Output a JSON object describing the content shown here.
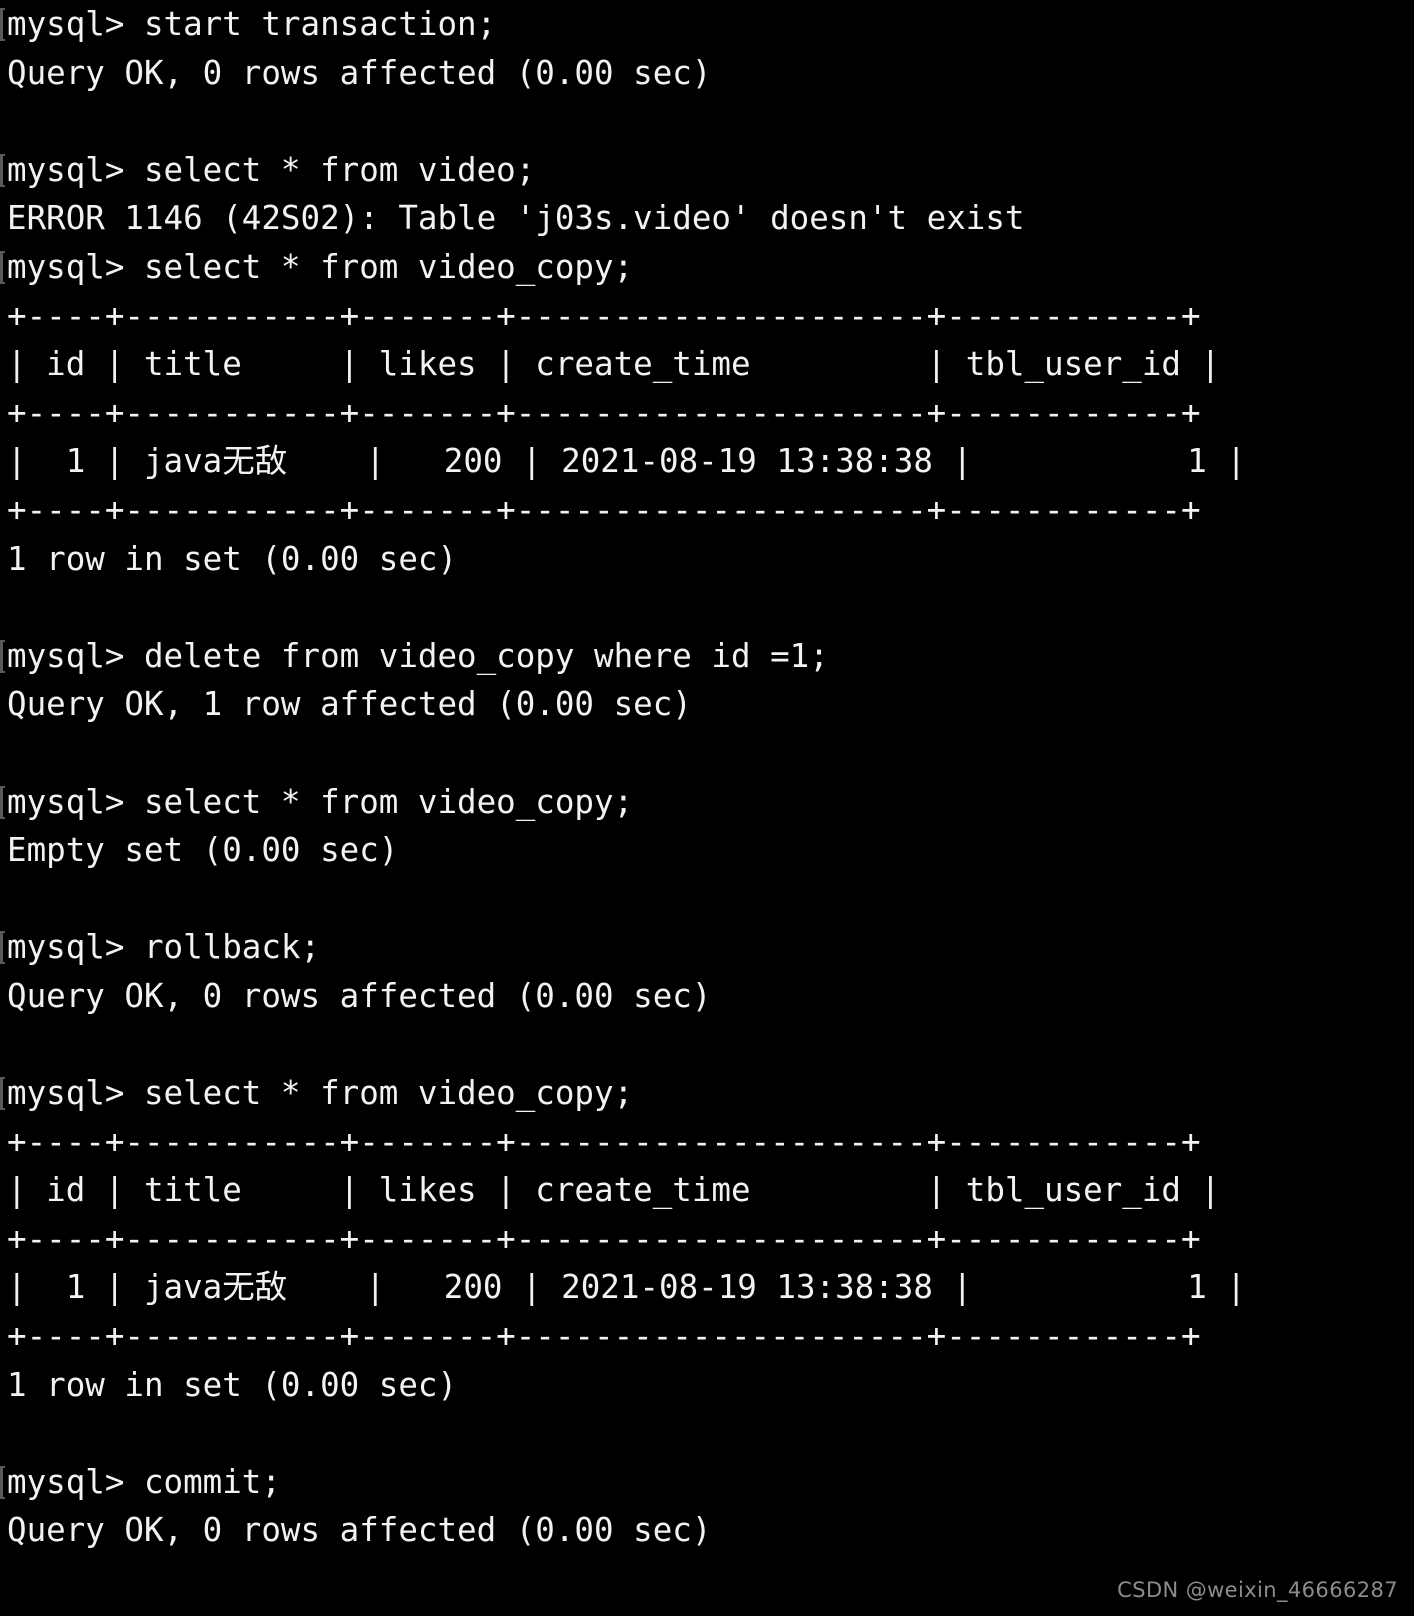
{
  "terminal": {
    "background_color": "#000000",
    "text_color": "#f2f2f2",
    "prompt": "mysql>",
    "lines": [
      {
        "kind": "prompt",
        "text": "mysql> start transaction;"
      },
      {
        "kind": "output",
        "text": "Query OK, 0 rows affected (0.00 sec)"
      },
      {
        "kind": "blank",
        "text": " "
      },
      {
        "kind": "prompt",
        "text": "mysql> select * from video;"
      },
      {
        "kind": "output",
        "text": "ERROR 1146 (42S02): Table 'j03s.video' doesn't exist"
      },
      {
        "kind": "prompt",
        "text": "mysql> select * from video_copy;"
      },
      {
        "kind": "output",
        "text": "+----+-----------+-------+---------------------+------------+"
      },
      {
        "kind": "output",
        "text": "| id | title     | likes | create_time         | tbl_user_id |"
      },
      {
        "kind": "output",
        "text": "+----+-----------+-------+---------------------+------------+"
      },
      {
        "kind": "output",
        "text": "|  1 | java无敌    |   200 | 2021-08-19 13:38:38 |           1 |"
      },
      {
        "kind": "output",
        "text": "+----+-----------+-------+---------------------+------------+"
      },
      {
        "kind": "output",
        "text": "1 row in set (0.00 sec)"
      },
      {
        "kind": "blank",
        "text": " "
      },
      {
        "kind": "prompt",
        "text": "mysql> delete from video_copy where id =1;"
      },
      {
        "kind": "output",
        "text": "Query OK, 1 row affected (0.00 sec)"
      },
      {
        "kind": "blank",
        "text": " "
      },
      {
        "kind": "prompt",
        "text": "mysql> select * from video_copy;"
      },
      {
        "kind": "output",
        "text": "Empty set (0.00 sec)"
      },
      {
        "kind": "blank",
        "text": " "
      },
      {
        "kind": "prompt",
        "text": "mysql> rollback;"
      },
      {
        "kind": "output",
        "text": "Query OK, 0 rows affected (0.00 sec)"
      },
      {
        "kind": "blank",
        "text": " "
      },
      {
        "kind": "prompt",
        "text": "mysql> select * from video_copy;"
      },
      {
        "kind": "output",
        "text": "+----+-----------+-------+---------------------+------------+"
      },
      {
        "kind": "output",
        "text": "| id | title     | likes | create_time         | tbl_user_id |"
      },
      {
        "kind": "output",
        "text": "+----+-----------+-------+---------------------+------------+"
      },
      {
        "kind": "output",
        "text": "|  1 | java无敌    |   200 | 2021-08-19 13:38:38 |           1 |"
      },
      {
        "kind": "output",
        "text": "+----+-----------+-------+---------------------+------------+"
      },
      {
        "kind": "output",
        "text": "1 row in set (0.00 sec)"
      },
      {
        "kind": "blank",
        "text": " "
      },
      {
        "kind": "prompt",
        "text": "mysql> commit;"
      },
      {
        "kind": "output",
        "text": "Query OK, 0 rows affected (0.00 sec)"
      }
    ],
    "commands": [
      "start transaction;",
      "select * from video;",
      "select * from video_copy;",
      "delete from video_copy where id =1;",
      "select * from video_copy;",
      "rollback;",
      "select * from video_copy;",
      "commit;"
    ],
    "results": {
      "start_transaction": "Query OK, 0 rows affected (0.00 sec)",
      "select_video_error": "ERROR 1146 (42S02): Table 'j03s.video' doesn't exist",
      "select_video_copy_first": "1 row in set (0.00 sec)",
      "delete": "Query OK, 1 row affected (0.00 sec)",
      "select_after_delete": "Empty set (0.00 sec)",
      "rollback": "Query OK, 0 rows affected (0.00 sec)",
      "select_after_rollback": "1 row in set (0.00 sec)",
      "commit": "Query OK, 0 rows affected (0.00 sec)"
    },
    "result_table": {
      "database": "j03s",
      "table_name": "video_copy",
      "columns": [
        "id",
        "title",
        "likes",
        "create_time",
        "tbl_user_id"
      ],
      "rows": [
        [
          "1",
          "java无敌",
          "200",
          "2021-08-19 13:38:38",
          "1"
        ]
      ],
      "row_count_text": "1 row in set (0.00 sec)"
    },
    "error": {
      "code": "1146",
      "sqlstate": "42S02",
      "message": "Table 'j03s.video' doesn't exist"
    }
  },
  "watermark": {
    "text": "CSDN @weixin_46666287",
    "color": "#8c8c8c"
  }
}
